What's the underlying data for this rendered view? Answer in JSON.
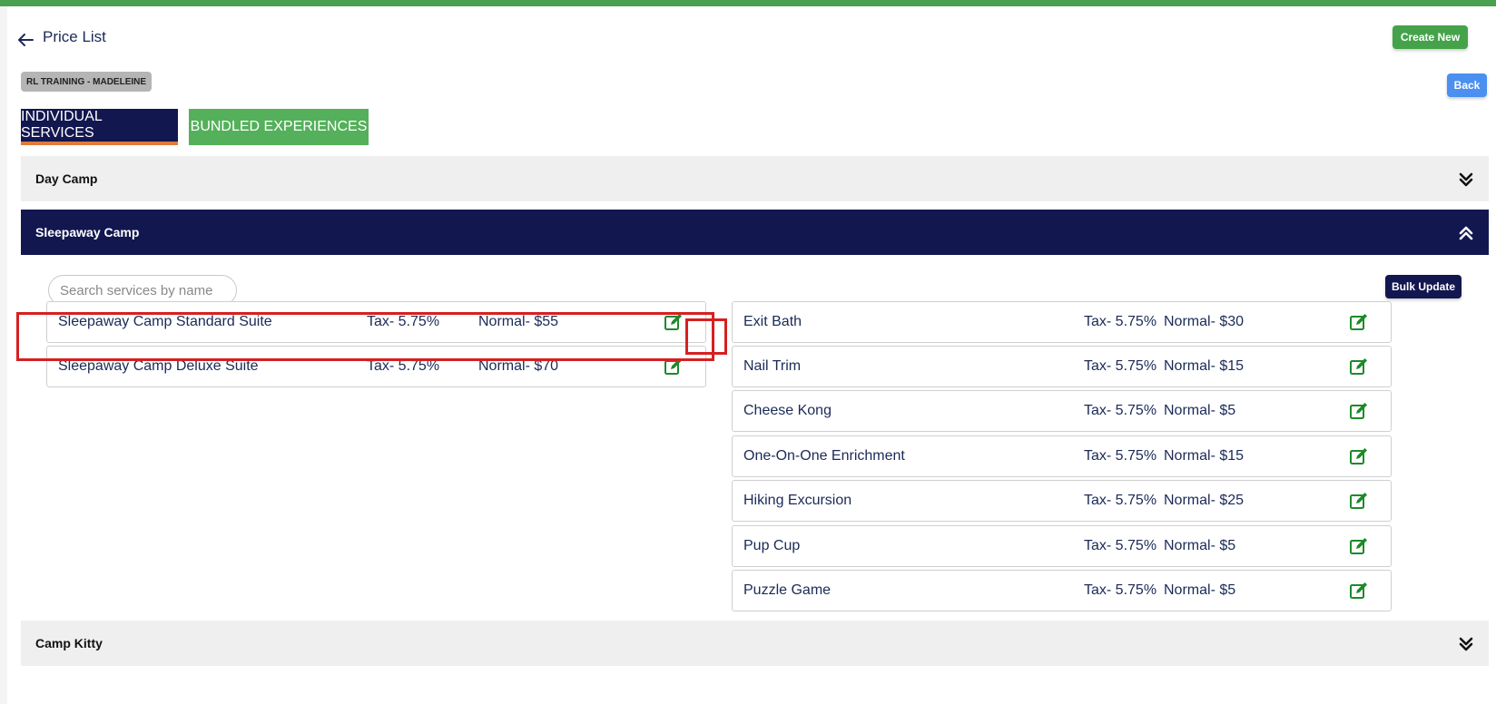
{
  "header": {
    "title": "Price List",
    "create_label": "Create New",
    "back_label": "Back"
  },
  "badge": "RL TRAINING - MADELEINE",
  "tabs": [
    {
      "label": "INDIVIDUAL SERVICES",
      "active": true
    },
    {
      "label": "BUNDLED EXPERIENCES",
      "active": false
    }
  ],
  "sections": {
    "day_camp": "Day Camp",
    "sleepaway": "Sleepaway Camp",
    "camp_kitty": "Camp Kitty"
  },
  "search": {
    "placeholder": "Search services by name",
    "value": ""
  },
  "bulk_update_label": "Bulk Update",
  "left_services": [
    {
      "name": "Sleepaway Camp Standard Suite",
      "tax": "Tax- 5.75%",
      "price": "Normal- $55"
    },
    {
      "name": "Sleepaway Camp Deluxe Suite",
      "tax": "Tax- 5.75%",
      "price": "Normal- $70"
    }
  ],
  "right_services": [
    {
      "name": "Exit Bath",
      "tax": "Tax- 5.75%",
      "price": "Normal- $30"
    },
    {
      "name": "Nail Trim",
      "tax": "Tax- 5.75%",
      "price": "Normal- $15"
    },
    {
      "name": "Cheese Kong",
      "tax": "Tax- 5.75%",
      "price": "Normal- $5"
    },
    {
      "name": "One-On-One Enrichment",
      "tax": "Tax- 5.75%",
      "price": "Normal- $15"
    },
    {
      "name": "Hiking Excursion",
      "tax": "Tax- 5.75%",
      "price": "Normal- $25"
    },
    {
      "name": "Pup Cup",
      "tax": "Tax- 5.75%",
      "price": "Normal- $5"
    },
    {
      "name": "Puzzle Game",
      "tax": "Tax- 5.75%",
      "price": "Normal- $5"
    }
  ],
  "icons": {
    "back": "arrow-left-icon",
    "expand": "double-chevron-down-icon",
    "collapse": "double-chevron-up-icon",
    "edit": "edit-icon"
  },
  "colors": {
    "brand_green": "#44a34a",
    "navy": "#12174f",
    "blue": "#4a90f0",
    "edit_green": "#1d8a2a",
    "highlight_red": "#d62020"
  }
}
